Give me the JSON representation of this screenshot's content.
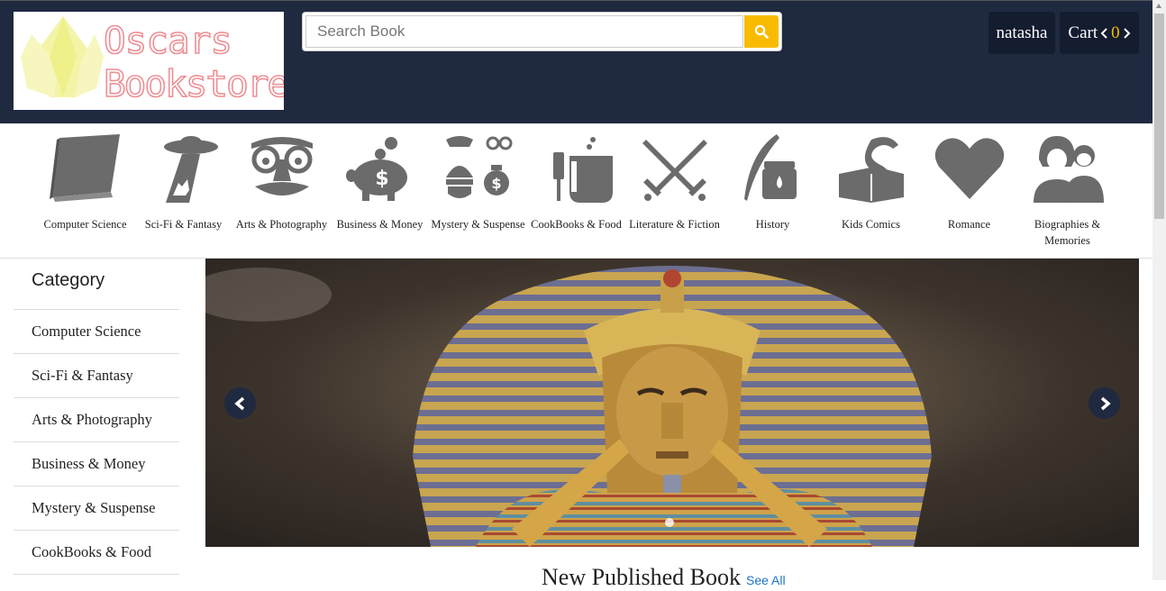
{
  "header": {
    "logo_line1": "Oscars",
    "logo_line2": "Bookstore",
    "search_placeholder": "Search Book",
    "user_name": "natasha",
    "cart_label": "Cart",
    "cart_count": "0"
  },
  "categories_bar": [
    {
      "label": "Computer Science",
      "icon": "book-icon"
    },
    {
      "label": "Sci-Fi & Fantasy",
      "icon": "ufo-icon"
    },
    {
      "label": "Arts & Photography",
      "icon": "disguise-glasses-icon"
    },
    {
      "label": "Business & Money",
      "icon": "piggy-bank-icon"
    },
    {
      "label": "Mystery & Suspense",
      "icon": "robber-icon"
    },
    {
      "label": "CookBooks & Food",
      "icon": "cooking-pot-icon"
    },
    {
      "label": "Literature & Fiction",
      "icon": "crossed-swords-icon"
    },
    {
      "label": "History",
      "icon": "quill-inkpot-icon"
    },
    {
      "label": "Kids Comics",
      "icon": "snake-book-icon"
    },
    {
      "label": "Romance",
      "icon": "heart-icon"
    },
    {
      "label": "Biographies & Memories",
      "icon": "people-icon"
    }
  ],
  "sidebar": {
    "title": "Category",
    "items": [
      "Computer Science",
      "Sci-Fi & Fantasy",
      "Arts & Photography",
      "Business & Money",
      "Mystery & Suspense",
      "CookBooks & Food"
    ]
  },
  "section": {
    "title": "New Published Book",
    "see_all": "See All"
  },
  "colors": {
    "header_bg": "#1f2940",
    "accent": "#f8bb00",
    "icon_gray": "#6b6b6b"
  }
}
